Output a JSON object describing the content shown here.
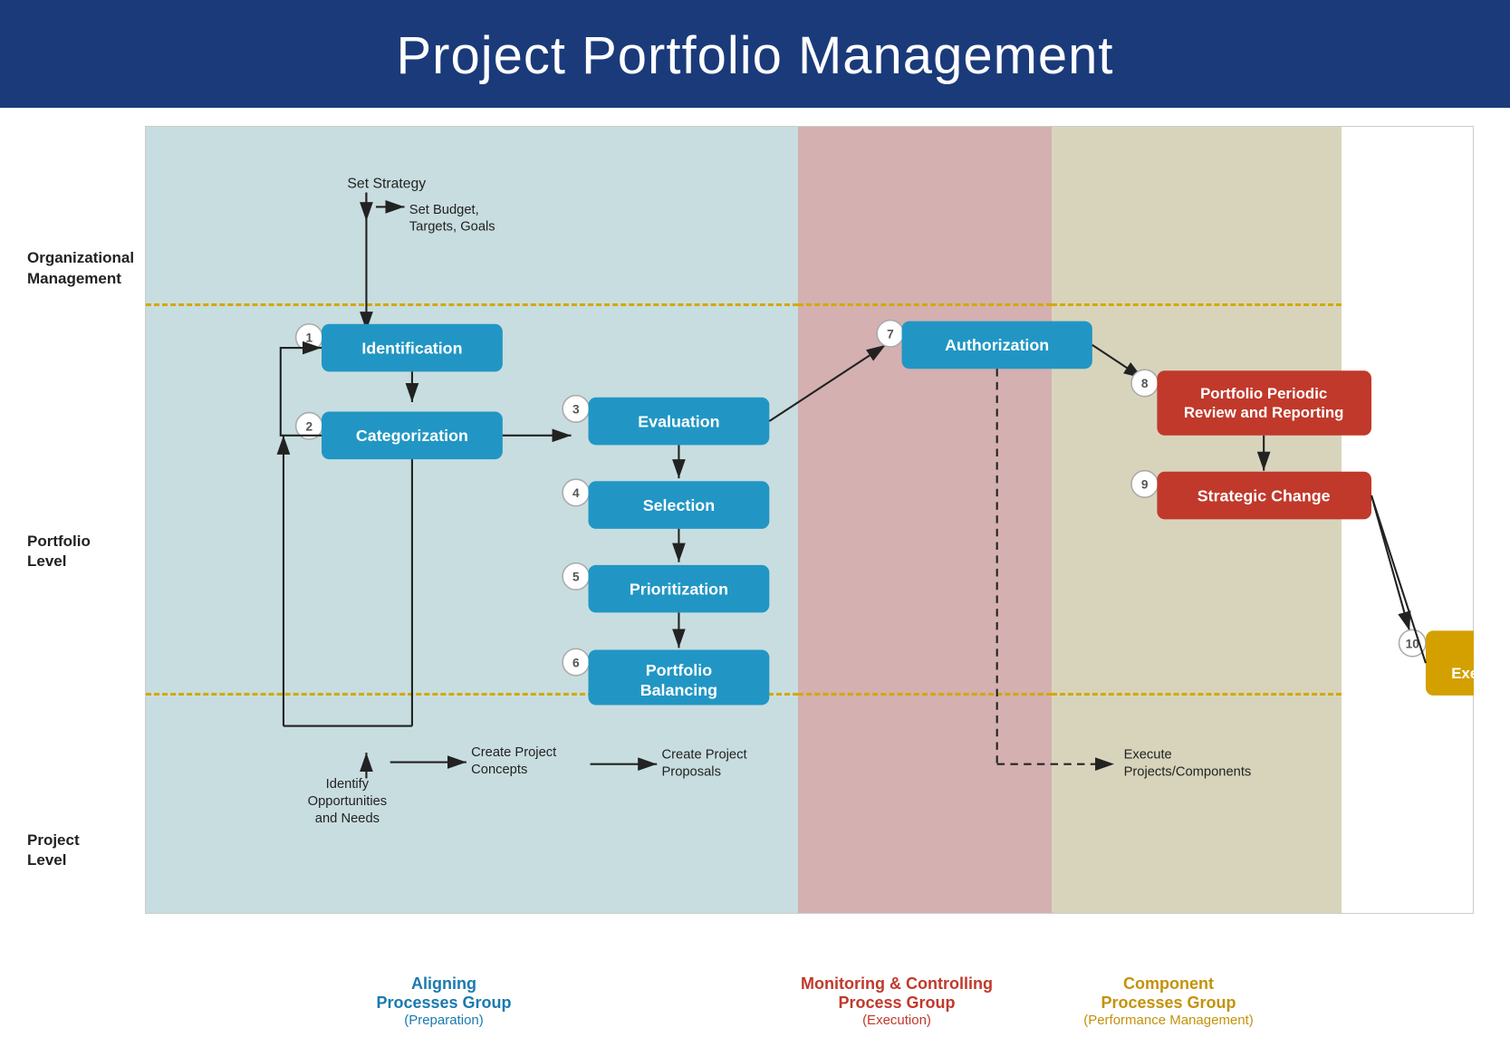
{
  "header": {
    "title": "Project Portfolio Management"
  },
  "row_labels": {
    "organizational": "Organizational\nManagement",
    "portfolio": "Portfolio\nLevel",
    "project": "Project\nLevel"
  },
  "strategy": {
    "set_strategy": "Set Strategy",
    "set_budget": "Set Budget,\nTargets, Goals"
  },
  "boxes": {
    "identification": "Identification",
    "categorization": "Categorization",
    "evaluation": "Evaluation",
    "selection": "Selection",
    "prioritization": "Prioritization",
    "portfolio_balancing": "Portfolio\nBalancing",
    "authorization": "Authorization",
    "portfolio_review": "Portfolio Periodic\nReview and Reporting",
    "strategic_change": "Strategic Change",
    "component_execution": "Component\nExecution Reporting"
  },
  "numbers": [
    "1",
    "2",
    "3",
    "4",
    "5",
    "6",
    "7",
    "8",
    "9",
    "10"
  ],
  "project_level": {
    "identify": "Identify\nOpportunities\nand Needs",
    "create_concepts": "Create Project\nConcepts",
    "create_proposals": "Create Project\nProposals",
    "execute": "Execute\nProjects/Components"
  },
  "bottom_labels": {
    "aligning_title": "Aligning\nProcesses Group",
    "aligning_sub": "(Preparation)",
    "monitoring_title": "Monitoring & Controlling\nProcess Group",
    "monitoring_sub": "(Execution)",
    "component_title": "Component\nProcesses Group",
    "component_sub": "(Performance Management)"
  }
}
